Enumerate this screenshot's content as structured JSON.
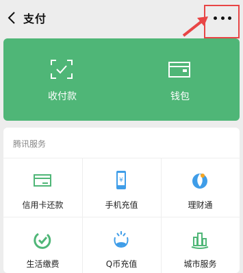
{
  "header": {
    "title": "支付"
  },
  "wallet_card": {
    "items": [
      {
        "label": "收付款",
        "icon": "scan-pay-icon"
      },
      {
        "label": "钱包",
        "icon": "wallet-icon"
      }
    ]
  },
  "services": {
    "title": "腾讯服务",
    "items": [
      {
        "label": "信用卡还款",
        "icon": "credit-card-icon"
      },
      {
        "label": "手机充值",
        "icon": "phone-recharge-icon"
      },
      {
        "label": "理财通",
        "icon": "wealth-icon"
      },
      {
        "label": "生活缴费",
        "icon": "bill-pay-icon"
      },
      {
        "label": "Q币充值",
        "icon": "qq-coin-icon"
      },
      {
        "label": "城市服务",
        "icon": "city-service-icon"
      }
    ]
  },
  "colors": {
    "brand_green": "#4fb677",
    "highlight_red": "#e84545"
  }
}
